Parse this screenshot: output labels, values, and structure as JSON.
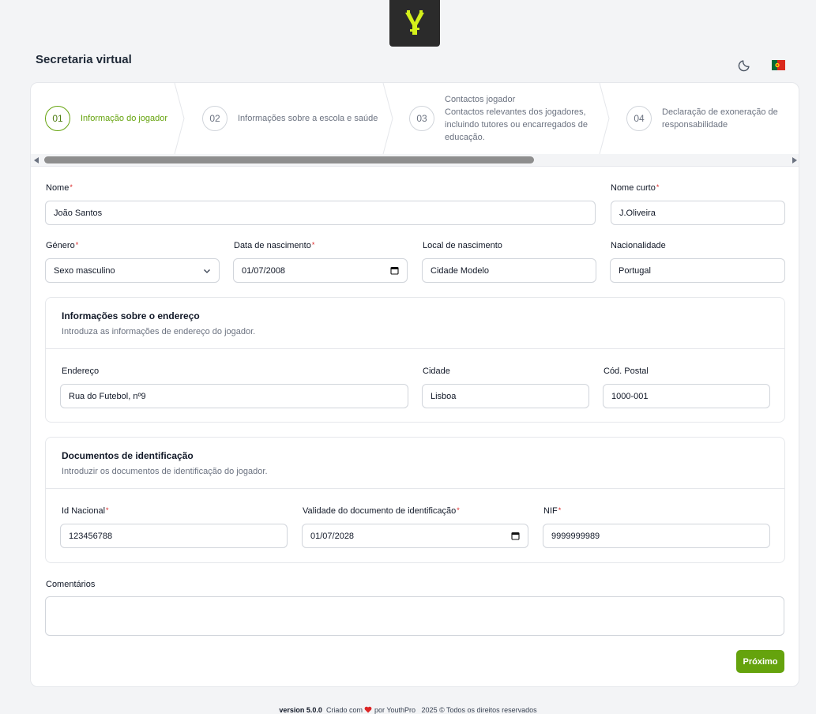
{
  "app": {
    "title": "Secretaria virtual"
  },
  "header": {
    "theme_icon": "moon-icon",
    "language_icon": "portugal-flag-icon"
  },
  "stepper": {
    "steps": [
      {
        "num": "01",
        "label": "Informação do jogador",
        "active": true
      },
      {
        "num": "02",
        "label": "Informações sobre a escola e saúde",
        "active": false
      },
      {
        "num": "03",
        "label": "Contactos jogador",
        "desc": "Contactos relevantes dos jogadores, incluindo tutores ou encarregados de educação.",
        "active": false
      },
      {
        "num": "04",
        "label": "Declaração de exoneração de responsabilidade",
        "active": false
      }
    ]
  },
  "form": {
    "nome": {
      "label": "Nome",
      "value": "João Santos",
      "required": true
    },
    "nome_curto": {
      "label": "Nome curto",
      "value": "J.Oliveira",
      "required": true
    },
    "genero": {
      "label": "Género",
      "value": "Sexo masculino",
      "required": true
    },
    "data_nascimento": {
      "label": "Data de nascimento",
      "value": "01/07/2008",
      "required": true
    },
    "local_nascimento": {
      "label": "Local de nascimento",
      "value": "Cidade Modelo"
    },
    "nacionalidade": {
      "label": "Nacionalidade",
      "value": "Portugal"
    },
    "address_section": {
      "title": "Informações sobre o endereço",
      "description": "Introduza as informações de endereço do jogador.",
      "endereco": {
        "label": "Endereço",
        "value": "Rua do Futebol, nº9"
      },
      "cidade": {
        "label": "Cidade",
        "value": "Lisboa"
      },
      "cod_postal": {
        "label": "Cód. Postal",
        "value": "1000-001"
      }
    },
    "id_section": {
      "title": "Documentos de identificação",
      "description": "Introduzir os documentos de identificação do jogador.",
      "id_nacional": {
        "label": "Id Nacional",
        "value": "123456788",
        "required": true
      },
      "validade": {
        "label": "Validade do documento de identificação",
        "value": "01/07/2028",
        "required": true
      },
      "nif": {
        "label": "NIF",
        "value": "9999999989",
        "required": true
      }
    },
    "comentarios": {
      "label": "Comentários",
      "value": ""
    },
    "next_label": "Próximo"
  },
  "footer": {
    "version": "version 5.0.0",
    "created_with": "Criado com",
    "by": "por YouthPro",
    "copyright": "2025 © Todos os direitos reservados"
  },
  "colors": {
    "accent": "#65a30d",
    "required": "#dc2626",
    "heart": "#dc2626"
  }
}
